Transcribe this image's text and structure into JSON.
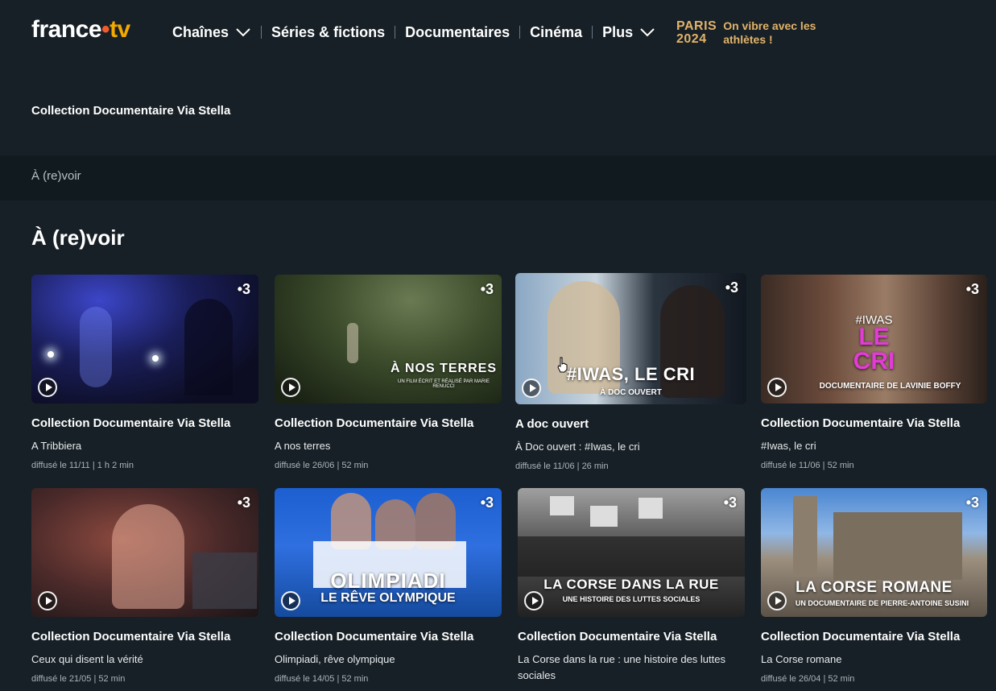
{
  "header": {
    "logo_france": "france",
    "logo_dot": "•",
    "logo_tv": "tv",
    "nav": [
      {
        "label": "Chaînes",
        "dropdown": true
      },
      {
        "label": "Séries & fictions",
        "dropdown": false
      },
      {
        "label": "Documentaires",
        "dropdown": false
      },
      {
        "label": "Cinéma",
        "dropdown": false
      },
      {
        "label": "Plus",
        "dropdown": true
      }
    ],
    "paris_line1": "PARIS",
    "paris_line2": "2024",
    "paris_tagline": "On vibre avec les athlètes !"
  },
  "page": {
    "title": "Collection Documentaire Via Stella",
    "tab": "À (re)voir",
    "section_title": "À (re)voir"
  },
  "channel_badge": "•3",
  "cards": [
    {
      "title": "Collection Documentaire Via Stella",
      "subtitle": "A Tribbiera",
      "meta": "diffusé le 11/11 | 1 h 2 min",
      "overlay": "",
      "overlay_sub": ""
    },
    {
      "title": "Collection Documentaire Via Stella",
      "subtitle": "A nos terres",
      "meta": "diffusé le 26/06 | 52 min",
      "overlay": "À NOS TERRES",
      "overlay_sub": "UN FILM ÉCRIT ET RÉALISÉ PAR MARIE RENUCCI"
    },
    {
      "title": "A doc ouvert",
      "subtitle": "À Doc ouvert : #Iwas, le cri",
      "meta": "diffusé le 11/06 | 26 min",
      "overlay": "#IWAS, LE CRI",
      "overlay_sub": "À DOC OUVERT"
    },
    {
      "title": "Collection Documentaire Via Stella",
      "subtitle": "#Iwas, le cri",
      "meta": "diffusé le 11/06 | 52 min",
      "overlay_hash": "#IWAS",
      "overlay_le": "LE",
      "overlay_cri": "CRI",
      "overlay_sub": "DOCUMENTAIRE DE LAVINIE BOFFY"
    },
    {
      "title": "Collection Documentaire Via Stella",
      "subtitle": "Ceux qui disent la vérité",
      "meta": "diffusé le 21/05 | 52 min",
      "overlay": "",
      "overlay_sub": ""
    },
    {
      "title": "Collection Documentaire Via Stella",
      "subtitle": "Olimpiadi, rêve olympique",
      "meta": "diffusé le 14/05 | 52 min",
      "overlay": "OLIMPIADI",
      "overlay_sub": "LE RÊVE OLYMPIQUE"
    },
    {
      "title": "Collection Documentaire Via Stella",
      "subtitle": "La Corse dans la rue : une histoire des luttes sociales",
      "meta": "",
      "overlay": "LA CORSE DANS LA RUE",
      "overlay_sub": "UNE HISTOIRE DES LUTTES SOCIALES"
    },
    {
      "title": "Collection Documentaire Via Stella",
      "subtitle": "La Corse romane",
      "meta": "diffusé le 26/04 | 52 min",
      "overlay": "LA CORSE ROMANE",
      "overlay_sub": "UN DOCUMENTAIRE DE PIERRE-ANTOINE SUSINI"
    }
  ],
  "colors": {
    "background": "#172026",
    "tabbar": "#111a1f",
    "logo_dot": "#f25c2b",
    "logo_tv": "#f2a900",
    "paris_gold": "#e2b36a"
  }
}
